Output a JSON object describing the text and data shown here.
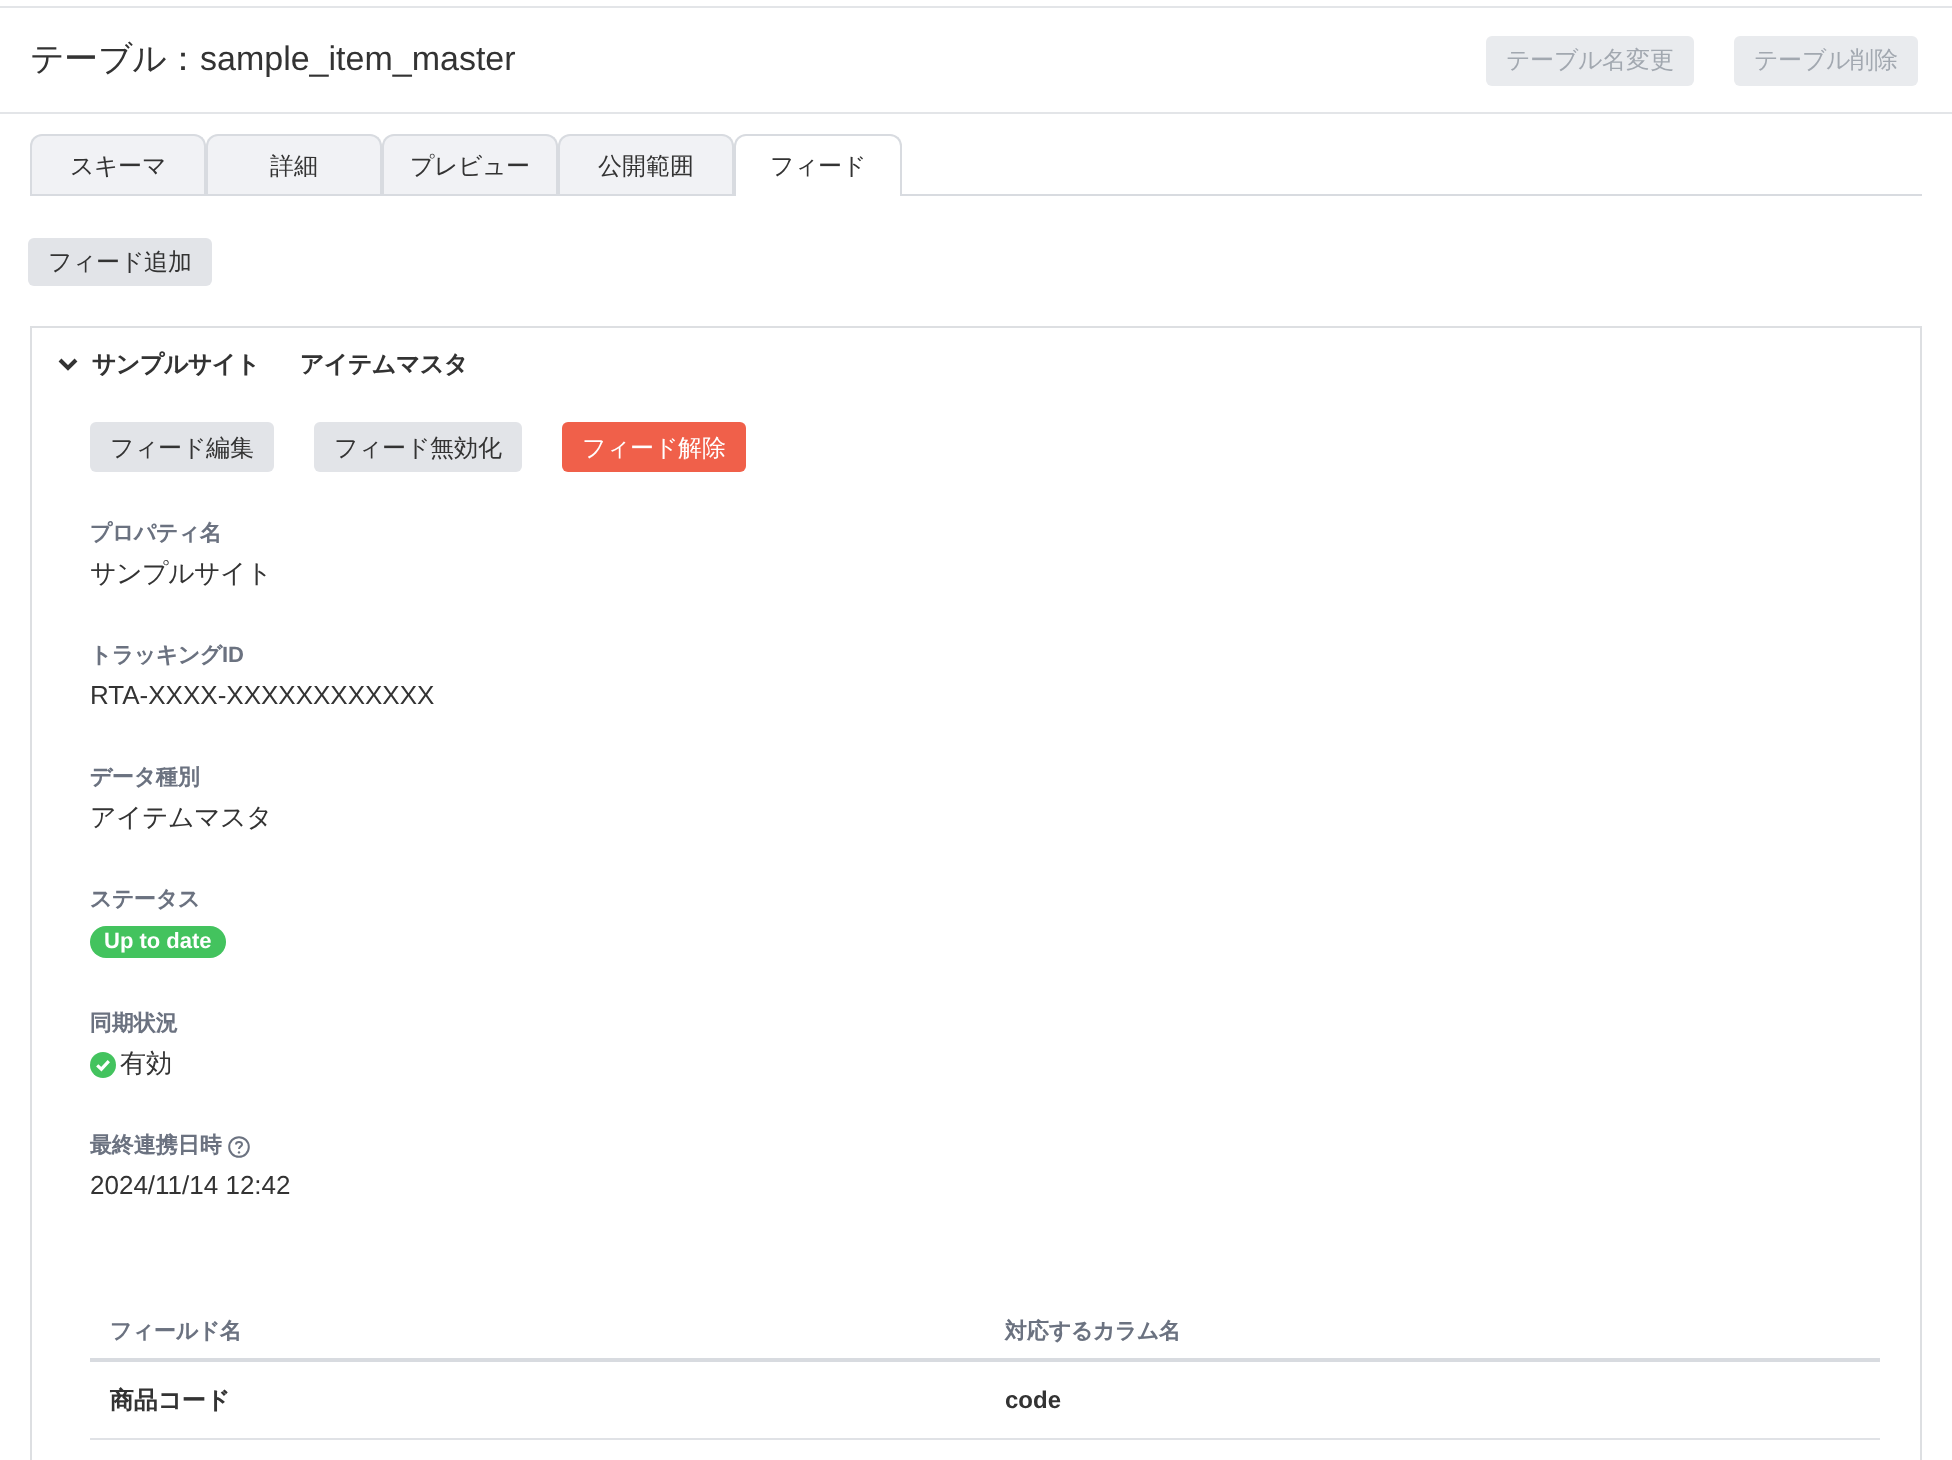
{
  "header": {
    "title": "テーブル：sample_item_master",
    "buttons": [
      {
        "label": "テーブル名変更",
        "disabled": true
      },
      {
        "label": "テーブル削除",
        "disabled": true
      }
    ]
  },
  "tabs": [
    {
      "label": "スキーマ",
      "selected": false
    },
    {
      "label": "詳細",
      "selected": false
    },
    {
      "label": "プレビュー",
      "selected": false
    },
    {
      "label": "公開範囲",
      "selected": false
    },
    {
      "label": "フィード",
      "selected": true
    }
  ],
  "add_button": "フィード追加",
  "feed": {
    "expanded": true,
    "property": "サンプルサイト",
    "data_type": "アイテムマスタ",
    "actions": [
      {
        "label": "フィード編集",
        "kind": "default"
      },
      {
        "label": "フィード無効化",
        "kind": "default"
      },
      {
        "label": "フィード解除",
        "kind": "danger"
      }
    ],
    "fields": [
      {
        "label": "プロパティ名",
        "kind": "text",
        "value": "サンプルサイト"
      },
      {
        "label": "トラッキングID",
        "kind": "text",
        "value": "RTA-XXXX-XXXXXXXXXXXX"
      },
      {
        "label": "データ種別",
        "kind": "text",
        "value": "アイテムマスタ"
      },
      {
        "label": "ステータス",
        "kind": "badge",
        "value": "Up to date"
      },
      {
        "label": "同期状況",
        "kind": "check",
        "value": "有効"
      },
      {
        "label": "最終連携日時",
        "kind": "text",
        "value": "2024/11/14 12:42",
        "help": true
      }
    ],
    "mapping": {
      "columns": [
        "フィールド名",
        "対応するカラム名"
      ],
      "rows": [
        [
          "商品コード",
          "code"
        ]
      ]
    }
  }
}
